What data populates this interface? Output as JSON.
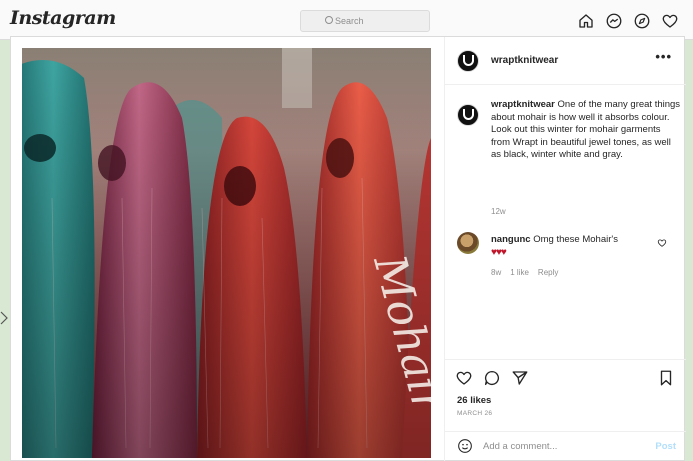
{
  "app": {
    "logo": "Instagram"
  },
  "search": {
    "placeholder": "Search"
  },
  "nav": [
    "home-icon",
    "messenger-icon",
    "explore-icon",
    "heart-icon"
  ],
  "post": {
    "author": "wraptknitwear",
    "more_label": "•••",
    "caption_text": "One of the many great things about mohair is how well it absorbs colour.",
    "caption_more": "Look out this winter for mohair garments from Wrapt in beautiful jewel tones, as well as black, winter white and gray.",
    "age": "12w",
    "image_watermark": "Mohair",
    "comments": [
      {
        "user": "nangunc",
        "text": "Omg these Mohair's",
        "emoji": "♥♥♥",
        "age": "8w",
        "likes": "1 like",
        "reply": "Reply"
      }
    ],
    "like_count": "26 likes",
    "date": "MARCH 26",
    "add_comment_placeholder": "Add a comment...",
    "post_button": "Post"
  },
  "colors": {
    "link_blue_disabled": "#b2dffc",
    "text": "#262626",
    "muted": "#8e8e8e"
  }
}
